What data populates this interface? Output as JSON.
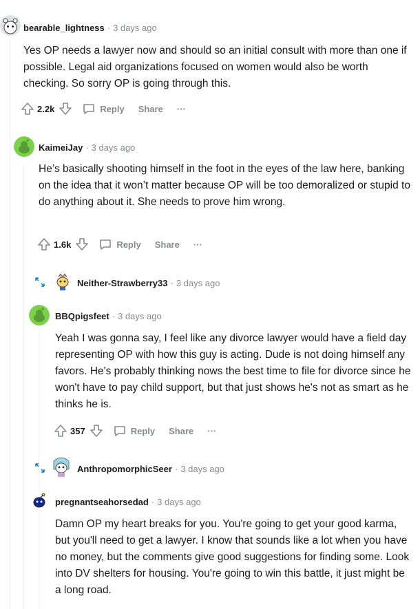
{
  "comments": [
    {
      "user": "bearable_lightness",
      "time": "3 days ago",
      "body": "Yes OP needs a lawyer now and should so an initial consult with more than one if possible. Legal aid organizations focused on women would also be worth checking. So sorry OP is going through this.",
      "score": "2.2k",
      "reply": "Reply",
      "share": "Share",
      "more": "···"
    },
    {
      "user": "KaimeiJay",
      "time": "3 days ago",
      "body": "He’s basically shooting himself in the foot in the eyes of the law here, banking on the idea that it won’t matter because OP will be too demoralized or stupid to do anything about it. She needs to prove him wrong.",
      "score": "1.6k",
      "reply": "Reply",
      "share": "Share",
      "more": "···"
    },
    {
      "user": "Neither-Strawberry33",
      "time": "3 days ago"
    },
    {
      "user": "BBQpigsfeet",
      "time": "3 days ago",
      "body": "Yeah I was gonna say, I feel like any divorce lawyer would have a field day representing OP with how this guy is acting. Dude is not doing himself any favors. He's probably thinking nows the best time to file for divorce since he won't have to pay child support, but that just shows he's not as smart as he thinks he is.",
      "score": "357",
      "reply": "Reply",
      "share": "Share",
      "more": "···"
    },
    {
      "user": "AnthropomorphicSeer",
      "time": "3 days ago"
    },
    {
      "user": "pregnantseahorsedad",
      "time": "3 days ago",
      "body": "Damn OP my heart breaks for you. You're going to get your good karma, but you'll need to get a lawyer. I know that sounds like a lot when you have no money, but the comments give good suggestions for finding some. Look into DV shelters for housing. You're going to win this battle, it just might be a long road."
    }
  ],
  "separator": "·",
  "colors": {
    "text": "#1c1c1c",
    "meta": "#878a8c",
    "thread": "#edeff1",
    "snoo_green": "#7bd14a",
    "snoo_blue": "#0079d3"
  },
  "icons": [
    "upvote-icon",
    "downvote-icon",
    "comment-icon",
    "expand-arrows-icon",
    "avatar-icon"
  ]
}
